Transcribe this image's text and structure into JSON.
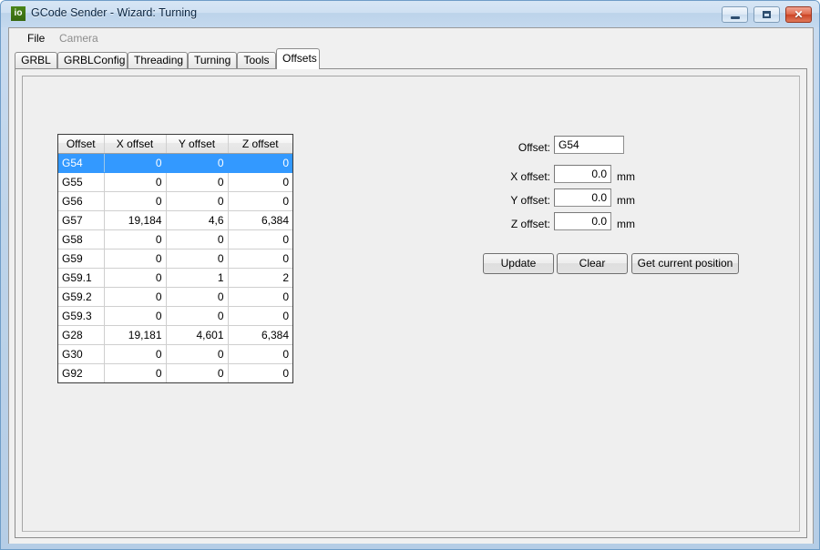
{
  "window": {
    "icon_label": "io",
    "title": "GCode Sender - Wizard: Turning",
    "controls": {
      "minimize": "minimize-button",
      "maximize": "maximize-button",
      "close": "✕"
    }
  },
  "menubar": {
    "items": [
      {
        "label": "File",
        "enabled": true
      },
      {
        "label": "Camera",
        "enabled": false
      }
    ]
  },
  "tabs": [
    {
      "label": "GRBL",
      "selected": false
    },
    {
      "label": "GRBLConfig",
      "selected": false
    },
    {
      "label": "Threading",
      "selected": false
    },
    {
      "label": "Turning",
      "selected": false
    },
    {
      "label": "Tools",
      "selected": false
    },
    {
      "label": "Offsets",
      "selected": true
    }
  ],
  "grid": {
    "columns": [
      "Offset",
      "X offset",
      "Y offset",
      "Z offset"
    ],
    "selected_row_index": 0,
    "rows": [
      {
        "offset": "G54",
        "x": "0",
        "y": "0",
        "z": "0"
      },
      {
        "offset": "G55",
        "x": "0",
        "y": "0",
        "z": "0"
      },
      {
        "offset": "G56",
        "x": "0",
        "y": "0",
        "z": "0"
      },
      {
        "offset": "G57",
        "x": "19,184",
        "y": "4,6",
        "z": "6,384"
      },
      {
        "offset": "G58",
        "x": "0",
        "y": "0",
        "z": "0"
      },
      {
        "offset": "G59",
        "x": "0",
        "y": "0",
        "z": "0"
      },
      {
        "offset": "G59.1",
        "x": "0",
        "y": "1",
        "z": "2"
      },
      {
        "offset": "G59.2",
        "x": "0",
        "y": "0",
        "z": "0"
      },
      {
        "offset": "G59.3",
        "x": "0",
        "y": "0",
        "z": "0"
      },
      {
        "offset": "G28",
        "x": "19,181",
        "y": "4,601",
        "z": "6,384"
      },
      {
        "offset": "G30",
        "x": "0",
        "y": "0",
        "z": "0"
      },
      {
        "offset": "G92",
        "x": "0",
        "y": "0",
        "z": "0"
      }
    ]
  },
  "form": {
    "offset_label": "Offset:",
    "offset_value": "G54",
    "x_label": "X offset:",
    "x_value": "0.0",
    "x_unit": "mm",
    "y_label": "Y offset:",
    "y_value": "0.0",
    "y_unit": "mm",
    "z_label": "Z offset:",
    "z_value": "0.0",
    "z_unit": "mm",
    "buttons": {
      "update": "Update",
      "clear": "Clear",
      "get_current_position": "Get current position"
    }
  },
  "colors": {
    "selection_blue": "#3399ff",
    "titlebar_blue": "#c4d9ee",
    "window_bg": "#f0f0f0",
    "icon_green": "#3f7516",
    "close_red": "#cb4324"
  }
}
